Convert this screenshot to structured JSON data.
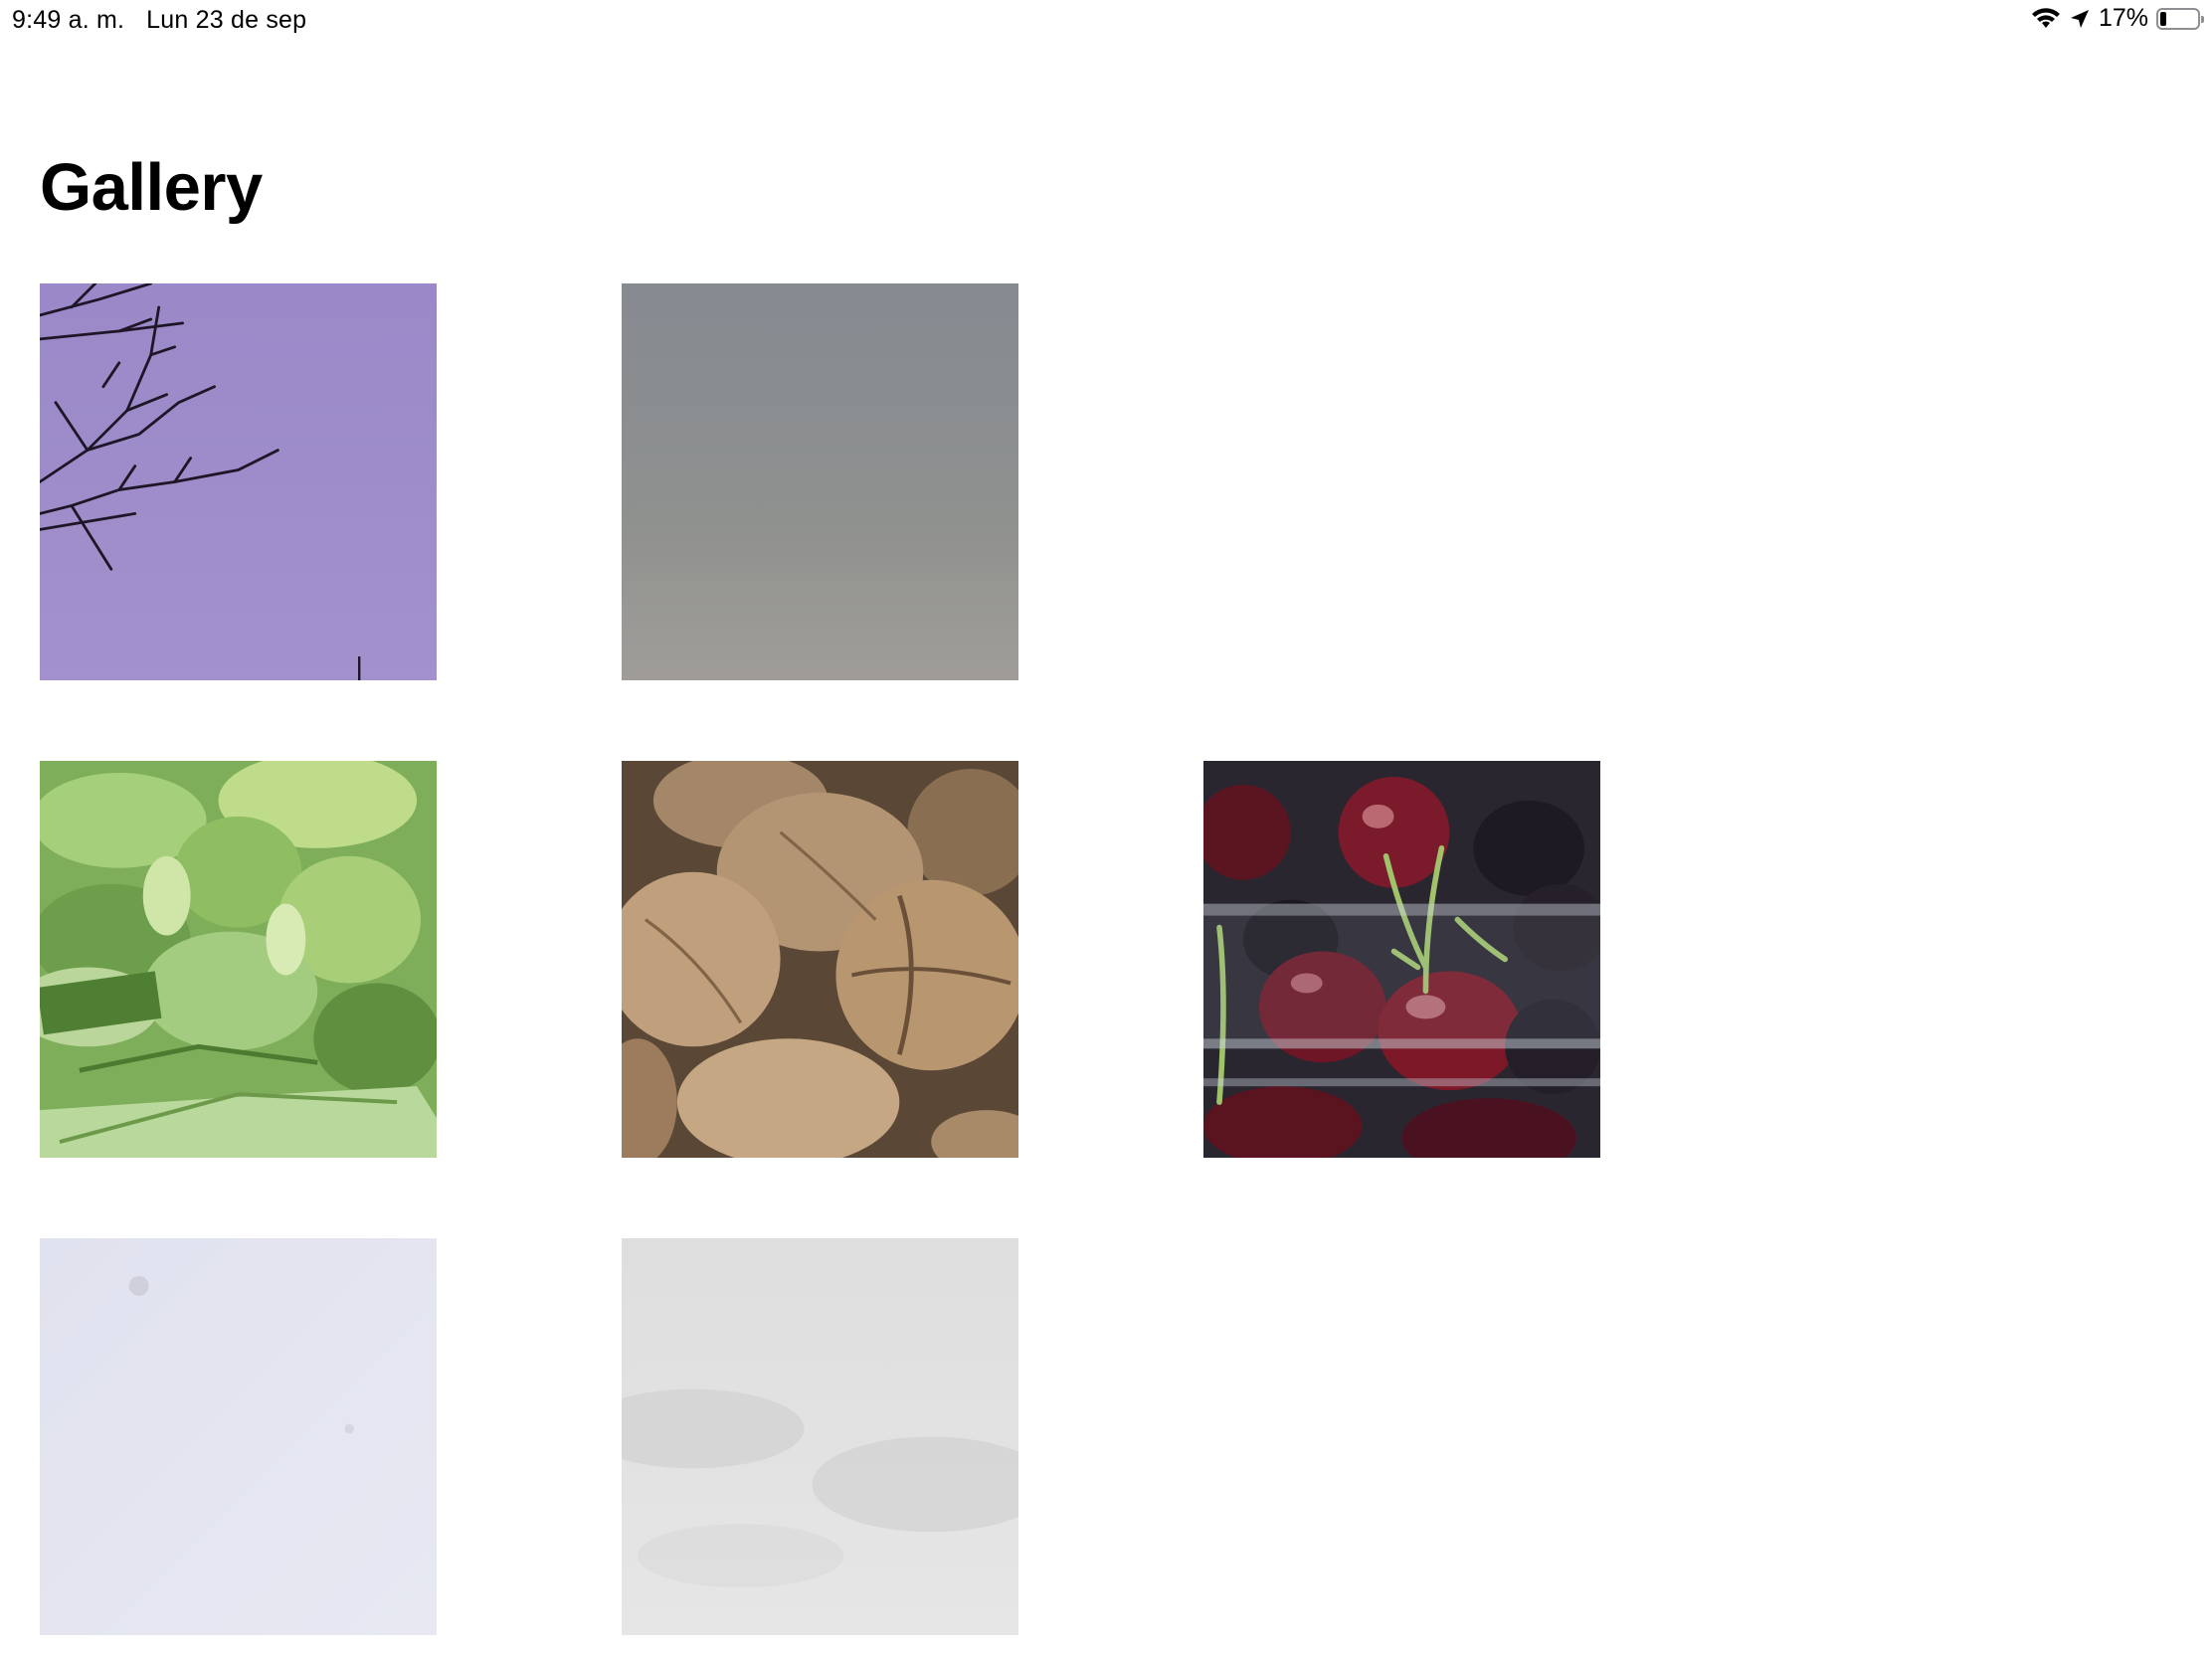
{
  "status_bar": {
    "time": "9:49 a. m.",
    "date": "Lun 23 de sep",
    "battery_text": "17%",
    "battery_level": 0.17,
    "icons": [
      "wifi-icon",
      "location-arrow-icon",
      "battery-icon"
    ]
  },
  "page": {
    "title": "Gallery"
  },
  "gallery": {
    "photos": [
      {
        "subject": "tree-branches-purple-sky",
        "dominant_color": "#9a89c8"
      },
      {
        "subject": "gray-sky",
        "dominant_color": "#8d8f93"
      },
      {
        "subject": "green-artichokes",
        "dominant_color": "#8fbf6a"
      },
      {
        "subject": "walnuts",
        "dominant_color": "#b09270"
      },
      {
        "subject": "cherries-in-containers",
        "dominant_color": "#5a1a2a"
      },
      {
        "subject": "pale-lavender-surface",
        "dominant_color": "#e4e5f1"
      },
      {
        "subject": "light-gray-clouds",
        "dominant_color": "#dcdcdc"
      }
    ]
  }
}
